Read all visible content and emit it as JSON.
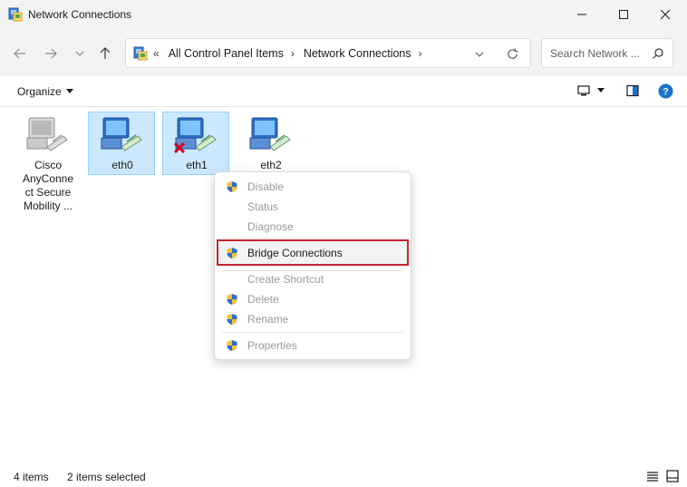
{
  "window": {
    "title": "Network Connections",
    "controls": [
      "minimize-icon",
      "maximize-icon",
      "close-icon"
    ]
  },
  "address": {
    "overflow": "«",
    "crumbs": [
      "All Control Panel Items",
      "Network Connections"
    ],
    "search_placeholder": "Search Network ..."
  },
  "toolbar": {
    "organize_label": "Organize"
  },
  "items": [
    {
      "label": "Cisco AnyConnect Secure Mobility ...",
      "lines": [
        "Cisco",
        "AnyConne",
        "ct Secure",
        "Mobility ..."
      ],
      "selected": false,
      "status": "normal"
    },
    {
      "label": "eth0",
      "selected": true,
      "status": "normal"
    },
    {
      "label": "eth1",
      "selected": true,
      "status": "disconnected"
    },
    {
      "label": "eth2",
      "selected": false,
      "status": "normal"
    }
  ],
  "context_menu": {
    "items": [
      {
        "label": "Disable",
        "enabled": false,
        "shield": true
      },
      {
        "label": "Status",
        "enabled": false,
        "shield": false
      },
      {
        "label": "Diagnose",
        "enabled": false,
        "shield": false
      },
      {
        "label": "Bridge Connections",
        "enabled": true,
        "shield": true,
        "highlighted": true
      },
      {
        "label": "Create Shortcut",
        "enabled": false,
        "shield": false
      },
      {
        "label": "Delete",
        "enabled": false,
        "shield": true
      },
      {
        "label": "Rename",
        "enabled": false,
        "shield": true
      },
      {
        "label": "Properties",
        "enabled": false,
        "shield": true
      }
    ]
  },
  "status": {
    "item_count": "4 items",
    "selected_count": "2 items selected"
  },
  "colors": {
    "selection_bg": "#cce8ff",
    "selection_border": "#99d1ff",
    "highlight_border": "#c4262e",
    "help_blue": "#1a73c9"
  }
}
